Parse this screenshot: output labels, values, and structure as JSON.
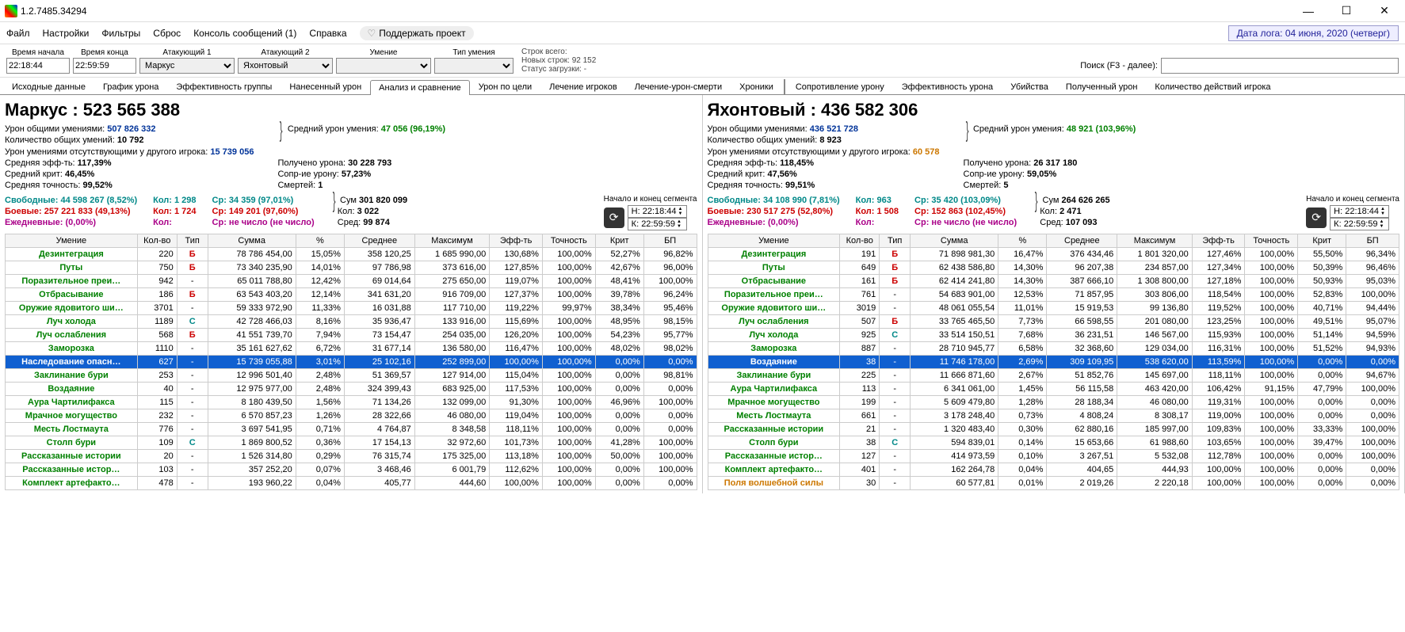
{
  "title": "1.2.7485.34294",
  "menu": [
    "Файл",
    "Настройки",
    "Фильтры",
    "Сброс",
    "Консоль сообщений (1)",
    "Справка"
  ],
  "support": "Поддержать проект",
  "datebadge": "Дата лога: 04 июня, 2020  (четверг)",
  "filters": {
    "labels": [
      "Время начала",
      "Время конца",
      "Атакующий 1",
      "Атакующий 2",
      "Умение",
      "Тип умения"
    ],
    "time_start": "22:18:44",
    "time_end": "22:59:59",
    "attacker1": "Маркус",
    "attacker2": "Яхонтовый",
    "skill": "",
    "skill_type": ""
  },
  "loadstats": {
    "l1": "Строк всего:",
    "l2": "Новых строк: 92 152",
    "l3": "Статус загрузки: -"
  },
  "search_label": "Поиск (F3 - далее):",
  "tabs": [
    "Исходные данные",
    "График урона",
    "Эффективность группы",
    "Нанесенный урон",
    "Анализ и сравнение",
    "Урон по цели",
    "Лечение игроков",
    "Лечение-урон-смерти",
    "Хроники",
    "Сопротивление урону",
    "Эффективность урона",
    "Убийства",
    "Полученный урон",
    "Количество действий игрока"
  ],
  "active_tab": 4,
  "columns": [
    "Умение",
    "Кол-во",
    "Тип",
    "Сумма",
    "%",
    "Среднее",
    "Максимум",
    "Эфф-ть",
    "Точность",
    "Крит",
    "БП"
  ],
  "segment_label": "Начало и конец\nсегмента",
  "panels": [
    {
      "name": "Маркус : 523 565 388",
      "stats": {
        "l1a": "Урон общими умениями:",
        "l1b": "507 826 332",
        "l1c": "Средний урон умения:",
        "l1d": "47 056 (96,19%)",
        "l2a": "Количество общих умений:",
        "l2b": "10 792",
        "l3a": "Урон умениями отсутствующими у другого игрока:",
        "l3b": "15 739 056",
        "l4a": "Средняя эфф-ть:",
        "l4b": "117,39%",
        "l4c": "Получено урона:",
        "l4d": "30 228 793",
        "l5a": "Средний крит:",
        "l5b": "46,45%",
        "l5c": "Сопр-ие урону:",
        "l5d": "57,23%",
        "l6a": "Средняя точность:",
        "l6b": "99,52%",
        "l6c": "Смертей:",
        "l6d": "1"
      },
      "seg": {
        "free_l": "Свободные:",
        "free_v": "44 598 267 (8,52%)",
        "combat_l": "Боевые:",
        "combat_v": "257 221 833 (49,13%)",
        "daily_l": "Ежедневные:",
        "daily_v": "(0,00%)",
        "cnt_l": "Кол:",
        "cnt1": "1 298",
        "cnt2": "1 724",
        "cnt3": "",
        "avg_l": "Ср:",
        "avg1": "34 359 (97,01%)",
        "avg2": "149 201 (97,60%)",
        "avg3": "не число (не число)",
        "sum_l": "Сум",
        "sum_v": "301 820 099",
        "kol_l": "Кол:",
        "kol_v": "3 022",
        "sred_l": "Сред:",
        "sred_v": "99 874",
        "t1": "22:18:44",
        "t2": "22:59:59"
      },
      "rows": [
        {
          "skill": "Дезинтеграция",
          "cls": "sk-green",
          "cnt": "220",
          "type": "Б",
          "sum": "78 786 454,00",
          "pct": "15,05%",
          "avg": "358 120,25",
          "max": "1 685 990,00",
          "eff": "130,68%",
          "acc": "100,00%",
          "crit": "52,27%",
          "bp": "96,82%",
          "sel": 0
        },
        {
          "skill": "Путы",
          "cls": "sk-green",
          "cnt": "750",
          "type": "Б",
          "sum": "73 340 235,90",
          "pct": "14,01%",
          "avg": "97 786,98",
          "max": "373 616,00",
          "eff": "127,85%",
          "acc": "100,00%",
          "crit": "42,67%",
          "bp": "96,00%",
          "sel": 0
        },
        {
          "skill": "Поразительное преи…",
          "cls": "sk-green",
          "cnt": "942",
          "type": "-",
          "sum": "65 011 788,80",
          "pct": "12,42%",
          "avg": "69 014,64",
          "max": "275 650,00",
          "eff": "119,07%",
          "acc": "100,00%",
          "crit": "48,41%",
          "bp": "100,00%",
          "sel": 0
        },
        {
          "skill": "Отбрасывание",
          "cls": "sk-green",
          "cnt": "186",
          "type": "Б",
          "sum": "63 543 403,20",
          "pct": "12,14%",
          "avg": "341 631,20",
          "max": "916 709,00",
          "eff": "127,37%",
          "acc": "100,00%",
          "crit": "39,78%",
          "bp": "96,24%",
          "sel": 0
        },
        {
          "skill": "Оружие ядовитого ши…",
          "cls": "sk-green",
          "cnt": "3701",
          "type": "-",
          "sum": "59 333 972,90",
          "pct": "11,33%",
          "avg": "16 031,88",
          "max": "117 710,00",
          "eff": "119,22%",
          "acc": "99,97%",
          "crit": "38,34%",
          "bp": "95,46%",
          "sel": 0
        },
        {
          "skill": "Луч холода",
          "cls": "sk-green",
          "cnt": "1189",
          "type": "С",
          "sum": "42 728 466,03",
          "pct": "8,16%",
          "avg": "35 936,47",
          "max": "133 916,00",
          "eff": "115,69%",
          "acc": "100,00%",
          "crit": "48,95%",
          "bp": "98,15%",
          "sel": 0
        },
        {
          "skill": "Луч ослабления",
          "cls": "sk-green",
          "cnt": "568",
          "type": "Б",
          "sum": "41 551 739,70",
          "pct": "7,94%",
          "avg": "73 154,47",
          "max": "254 035,00",
          "eff": "126,20%",
          "acc": "100,00%",
          "crit": "54,23%",
          "bp": "95,77%",
          "sel": 0
        },
        {
          "skill": "Заморозка",
          "cls": "sk-green",
          "cnt": "1110",
          "type": "-",
          "sum": "35 161 627,62",
          "pct": "6,72%",
          "avg": "31 677,14",
          "max": "136 580,00",
          "eff": "116,47%",
          "acc": "100,00%",
          "crit": "48,02%",
          "bp": "98,02%",
          "sel": 0
        },
        {
          "skill": "Наследование опасн…",
          "cls": "",
          "cnt": "627",
          "type": "-",
          "sum": "15 739 055,88",
          "pct": "3,01%",
          "avg": "25 102,16",
          "max": "252 899,00",
          "eff": "100,00%",
          "acc": "100,00%",
          "crit": "0,00%",
          "bp": "0,00%",
          "sel": 1
        },
        {
          "skill": "Заклинание бури",
          "cls": "sk-green",
          "cnt": "253",
          "type": "-",
          "sum": "12 996 501,40",
          "pct": "2,48%",
          "avg": "51 369,57",
          "max": "127 914,00",
          "eff": "115,04%",
          "acc": "100,00%",
          "crit": "0,00%",
          "bp": "98,81%",
          "sel": 0
        },
        {
          "skill": "Воздаяние",
          "cls": "sk-green",
          "cnt": "40",
          "type": "-",
          "sum": "12 975 977,00",
          "pct": "2,48%",
          "avg": "324 399,43",
          "max": "683 925,00",
          "eff": "117,53%",
          "acc": "100,00%",
          "crit": "0,00%",
          "bp": "0,00%",
          "sel": 0
        },
        {
          "skill": "Аура Чартилифакса",
          "cls": "sk-green",
          "cnt": "115",
          "type": "-",
          "sum": "8 180 439,50",
          "pct": "1,56%",
          "avg": "71 134,26",
          "max": "132 099,00",
          "eff": "91,30%",
          "acc": "100,00%",
          "crit": "46,96%",
          "bp": "100,00%",
          "sel": 0
        },
        {
          "skill": "Мрачное могущество",
          "cls": "sk-green",
          "cnt": "232",
          "type": "-",
          "sum": "6 570 857,23",
          "pct": "1,26%",
          "avg": "28 322,66",
          "max": "46 080,00",
          "eff": "119,04%",
          "acc": "100,00%",
          "crit": "0,00%",
          "bp": "0,00%",
          "sel": 0
        },
        {
          "skill": "Месть Лостмаута",
          "cls": "sk-green",
          "cnt": "776",
          "type": "-",
          "sum": "3 697 541,95",
          "pct": "0,71%",
          "avg": "4 764,87",
          "max": "8 348,58",
          "eff": "118,11%",
          "acc": "100,00%",
          "crit": "0,00%",
          "bp": "0,00%",
          "sel": 0
        },
        {
          "skill": "Столп бури",
          "cls": "sk-green",
          "cnt": "109",
          "type": "С",
          "sum": "1 869 800,52",
          "pct": "0,36%",
          "avg": "17 154,13",
          "max": "32 972,60",
          "eff": "101,73%",
          "acc": "100,00%",
          "crit": "41,28%",
          "bp": "100,00%",
          "sel": 0
        },
        {
          "skill": "Рассказанные истории",
          "cls": "sk-green",
          "cnt": "20",
          "type": "-",
          "sum": "1 526 314,80",
          "pct": "0,29%",
          "avg": "76 315,74",
          "max": "175 325,00",
          "eff": "113,18%",
          "acc": "100,00%",
          "crit": "50,00%",
          "bp": "100,00%",
          "sel": 0
        },
        {
          "skill": "Рассказанные истор…",
          "cls": "sk-green",
          "cnt": "103",
          "type": "-",
          "sum": "357 252,20",
          "pct": "0,07%",
          "avg": "3 468,46",
          "max": "6 001,79",
          "eff": "112,62%",
          "acc": "100,00%",
          "crit": "0,00%",
          "bp": "100,00%",
          "sel": 0
        },
        {
          "skill": "Комплект артефакто…",
          "cls": "sk-green",
          "cnt": "478",
          "type": "-",
          "sum": "193 960,22",
          "pct": "0,04%",
          "avg": "405,77",
          "max": "444,60",
          "eff": "100,00%",
          "acc": "100,00%",
          "crit": "0,00%",
          "bp": "0,00%",
          "sel": 0
        }
      ]
    },
    {
      "name": "Яхонтовый : 436 582 306",
      "stats": {
        "l1a": "Урон общими умениями:",
        "l1b": "436 521 728",
        "l1c": "Средний урон умения:",
        "l1d": "48 921 (103,96%)",
        "l2a": "Количество общих умений:",
        "l2b": "8 923",
        "l3a": "Урон умениями отсутствующими у другого игрока:",
        "l3b": "60 578",
        "l4a": "Средняя эфф-ть:",
        "l4b": "118,45%",
        "l4c": "Получено урона:",
        "l4d": "26 317 180",
        "l5a": "Средний крит:",
        "l5b": "47,56%",
        "l5c": "Сопр-ие урону:",
        "l5d": "59,05%",
        "l6a": "Средняя точность:",
        "l6b": "99,51%",
        "l6c": "Смертей:",
        "l6d": "5"
      },
      "seg": {
        "free_l": "Свободные:",
        "free_v": "34 108 990 (7,81%)",
        "combat_l": "Боевые:",
        "combat_v": "230 517 275 (52,80%)",
        "daily_l": "Ежедневные:",
        "daily_v": "(0,00%)",
        "cnt_l": "Кол:",
        "cnt1": "963",
        "cnt2": "1 508",
        "cnt3": "",
        "avg_l": "Ср:",
        "avg1": "35 420 (103,09%)",
        "avg2": "152 863 (102,45%)",
        "avg3": "не число (не число)",
        "sum_l": "Сум",
        "sum_v": "264 626 265",
        "kol_l": "Кол:",
        "kol_v": "2 471",
        "sred_l": "Сред:",
        "sred_v": "107 093",
        "t1": "22:18:44",
        "t2": "22:59:59"
      },
      "rows": [
        {
          "skill": "Дезинтеграция",
          "cls": "sk-green",
          "cnt": "191",
          "type": "Б",
          "sum": "71 898 981,30",
          "pct": "16,47%",
          "avg": "376 434,46",
          "max": "1 801 320,00",
          "eff": "127,46%",
          "acc": "100,00%",
          "crit": "55,50%",
          "bp": "96,34%",
          "sel": 0
        },
        {
          "skill": "Путы",
          "cls": "sk-green",
          "cnt": "649",
          "type": "Б",
          "sum": "62 438 586,80",
          "pct": "14,30%",
          "avg": "96 207,38",
          "max": "234 857,00",
          "eff": "127,34%",
          "acc": "100,00%",
          "crit": "50,39%",
          "bp": "96,46%",
          "sel": 0
        },
        {
          "skill": "Отбрасывание",
          "cls": "sk-green",
          "cnt": "161",
          "type": "Б",
          "sum": "62 414 241,80",
          "pct": "14,30%",
          "avg": "387 666,10",
          "max": "1 308 800,00",
          "eff": "127,18%",
          "acc": "100,00%",
          "crit": "50,93%",
          "bp": "95,03%",
          "sel": 0
        },
        {
          "skill": "Поразительное преи…",
          "cls": "sk-green",
          "cnt": "761",
          "type": "-",
          "sum": "54 683 901,00",
          "pct": "12,53%",
          "avg": "71 857,95",
          "max": "303 806,00",
          "eff": "118,54%",
          "acc": "100,00%",
          "crit": "52,83%",
          "bp": "100,00%",
          "sel": 0
        },
        {
          "skill": "Оружие ядовитого ши…",
          "cls": "sk-green",
          "cnt": "3019",
          "type": "-",
          "sum": "48 061 055,54",
          "pct": "11,01%",
          "avg": "15 919,53",
          "max": "99 136,80",
          "eff": "119,52%",
          "acc": "100,00%",
          "crit": "40,71%",
          "bp": "94,44%",
          "sel": 0
        },
        {
          "skill": "Луч ослабления",
          "cls": "sk-green",
          "cnt": "507",
          "type": "Б",
          "sum": "33 765 465,50",
          "pct": "7,73%",
          "avg": "66 598,55",
          "max": "201 080,00",
          "eff": "123,25%",
          "acc": "100,00%",
          "crit": "49,51%",
          "bp": "95,07%",
          "sel": 0
        },
        {
          "skill": "Луч холода",
          "cls": "sk-green",
          "cnt": "925",
          "type": "С",
          "sum": "33 514 150,51",
          "pct": "7,68%",
          "avg": "36 231,51",
          "max": "146 567,00",
          "eff": "115,93%",
          "acc": "100,00%",
          "crit": "51,14%",
          "bp": "94,59%",
          "sel": 0
        },
        {
          "skill": "Заморозка",
          "cls": "sk-green",
          "cnt": "887",
          "type": "-",
          "sum": "28 710 945,77",
          "pct": "6,58%",
          "avg": "32 368,60",
          "max": "129 034,00",
          "eff": "116,31%",
          "acc": "100,00%",
          "crit": "51,52%",
          "bp": "94,93%",
          "sel": 0
        },
        {
          "skill": "Воздаяние",
          "cls": "",
          "cnt": "38",
          "type": "-",
          "sum": "11 746 178,00",
          "pct": "2,69%",
          "avg": "309 109,95",
          "max": "538 620,00",
          "eff": "113,59%",
          "acc": "100,00%",
          "crit": "0,00%",
          "bp": "0,00%",
          "sel": 1
        },
        {
          "skill": "Заклинание бури",
          "cls": "sk-green",
          "cnt": "225",
          "type": "-",
          "sum": "11 666 871,60",
          "pct": "2,67%",
          "avg": "51 852,76",
          "max": "145 697,00",
          "eff": "118,11%",
          "acc": "100,00%",
          "crit": "0,00%",
          "bp": "94,67%",
          "sel": 0
        },
        {
          "skill": "Аура Чартилифакса",
          "cls": "sk-green",
          "cnt": "113",
          "type": "-",
          "sum": "6 341 061,00",
          "pct": "1,45%",
          "avg": "56 115,58",
          "max": "463 420,00",
          "eff": "106,42%",
          "acc": "91,15%",
          "crit": "47,79%",
          "bp": "100,00%",
          "sel": 0
        },
        {
          "skill": "Мрачное могущество",
          "cls": "sk-green",
          "cnt": "199",
          "type": "-",
          "sum": "5 609 479,80",
          "pct": "1,28%",
          "avg": "28 188,34",
          "max": "46 080,00",
          "eff": "119,31%",
          "acc": "100,00%",
          "crit": "0,00%",
          "bp": "0,00%",
          "sel": 0
        },
        {
          "skill": "Месть Лостмаута",
          "cls": "sk-green",
          "cnt": "661",
          "type": "-",
          "sum": "3 178 248,40",
          "pct": "0,73%",
          "avg": "4 808,24",
          "max": "8 308,17",
          "eff": "119,00%",
          "acc": "100,00%",
          "crit": "0,00%",
          "bp": "0,00%",
          "sel": 0
        },
        {
          "skill": "Рассказанные истории",
          "cls": "sk-green",
          "cnt": "21",
          "type": "-",
          "sum": "1 320 483,40",
          "pct": "0,30%",
          "avg": "62 880,16",
          "max": "185 997,00",
          "eff": "109,83%",
          "acc": "100,00%",
          "crit": "33,33%",
          "bp": "100,00%",
          "sel": 0
        },
        {
          "skill": "Столп бури",
          "cls": "sk-green",
          "cnt": "38",
          "type": "С",
          "sum": "594 839,01",
          "pct": "0,14%",
          "avg": "15 653,66",
          "max": "61 988,60",
          "eff": "103,65%",
          "acc": "100,00%",
          "crit": "39,47%",
          "bp": "100,00%",
          "sel": 0
        },
        {
          "skill": "Рассказанные истор…",
          "cls": "sk-green",
          "cnt": "127",
          "type": "-",
          "sum": "414 973,59",
          "pct": "0,10%",
          "avg": "3 267,51",
          "max": "5 532,08",
          "eff": "112,78%",
          "acc": "100,00%",
          "crit": "0,00%",
          "bp": "100,00%",
          "sel": 0
        },
        {
          "skill": "Комплект артефакто…",
          "cls": "sk-green",
          "cnt": "401",
          "type": "-",
          "sum": "162 264,78",
          "pct": "0,04%",
          "avg": "404,65",
          "max": "444,93",
          "eff": "100,00%",
          "acc": "100,00%",
          "crit": "0,00%",
          "bp": "0,00%",
          "sel": 0
        },
        {
          "skill": "Поля волшебной силы",
          "cls": "sk-orange",
          "cnt": "30",
          "type": "-",
          "sum": "60 577,81",
          "pct": "0,01%",
          "avg": "2 019,26",
          "max": "2 220,18",
          "eff": "100,00%",
          "acc": "100,00%",
          "crit": "0,00%",
          "bp": "0,00%",
          "sel": 0
        }
      ]
    }
  ]
}
